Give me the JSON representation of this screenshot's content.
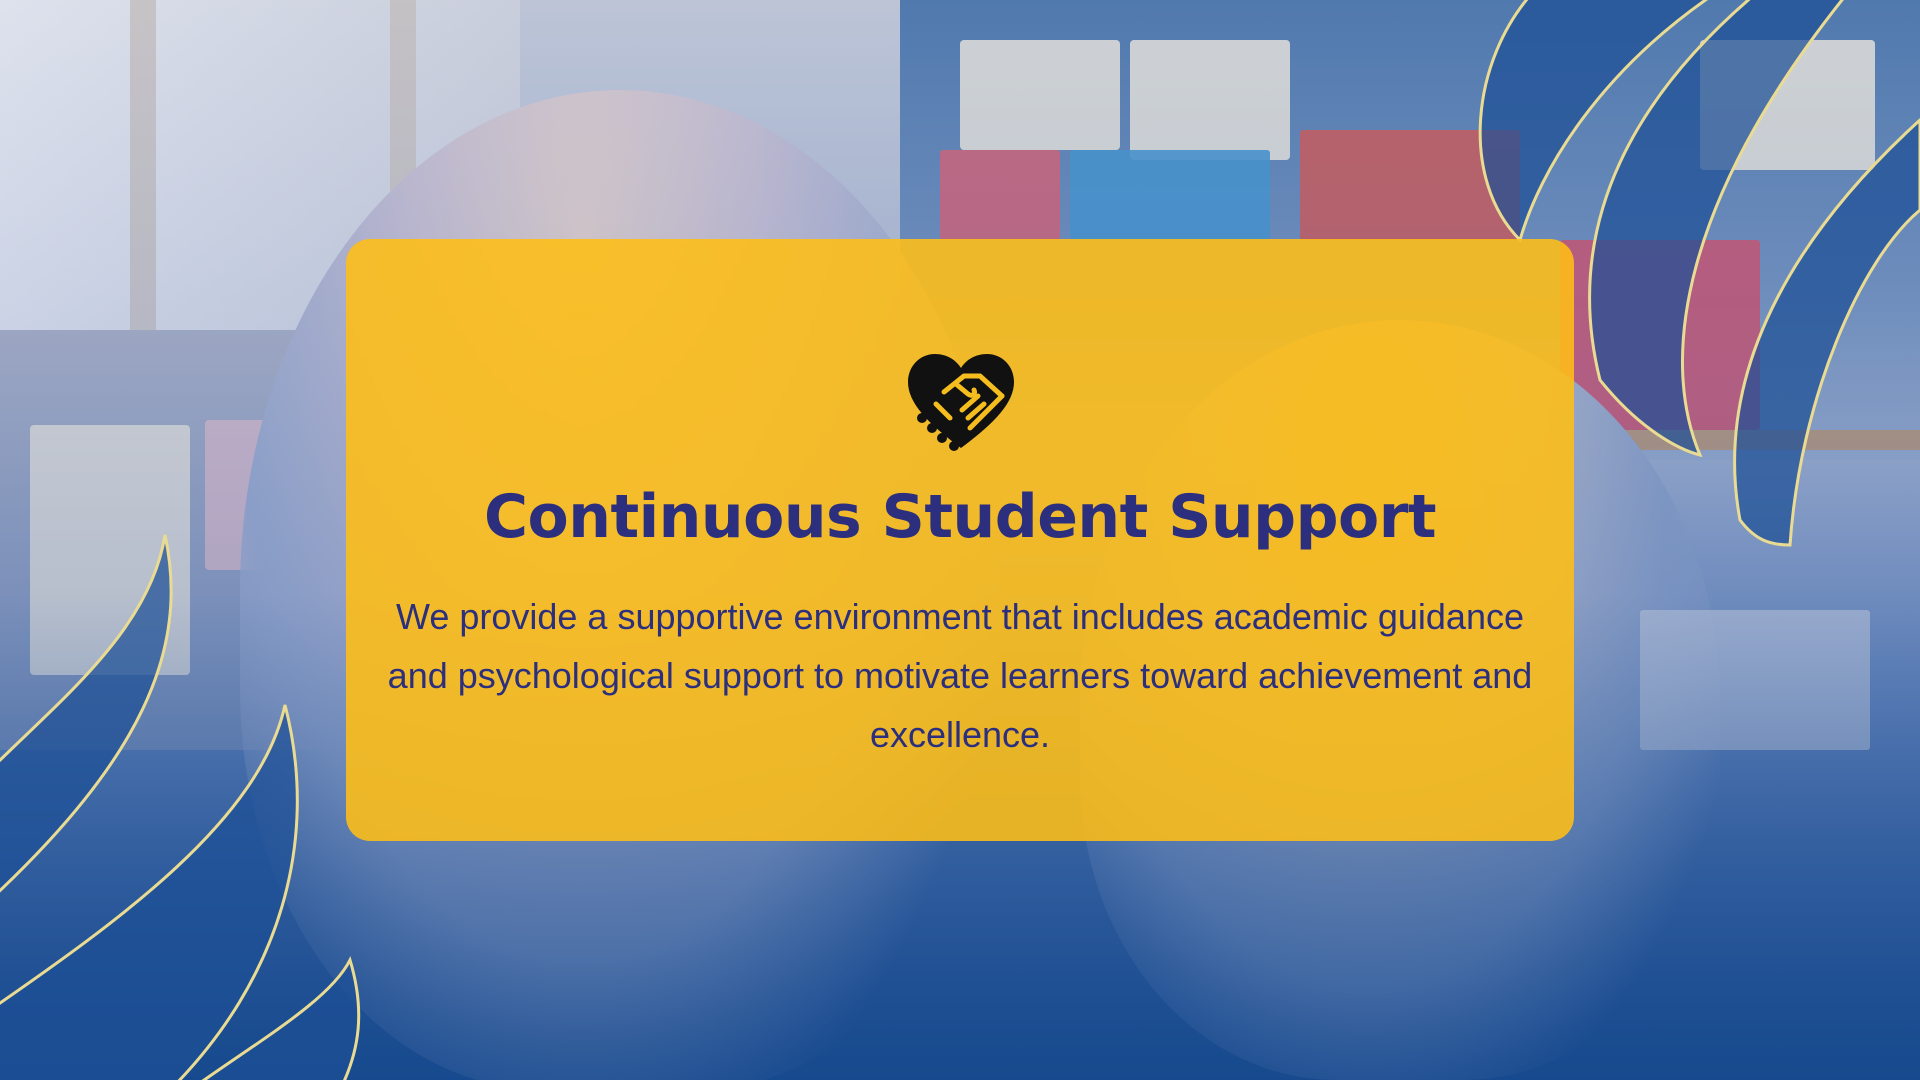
{
  "card": {
    "icon": "handshake-heart-icon",
    "title": "Continuous Student Support",
    "body": "We provide a supportive environment that includes academic guidance and psychological support to motivate learners toward achievement and excellence."
  },
  "colors": {
    "card_background": "#FFBE14",
    "text": "#2B2F7E",
    "icon": "#111111",
    "decorative_stroke": "#E8D58A",
    "overlay_blue": "#1F5394"
  }
}
